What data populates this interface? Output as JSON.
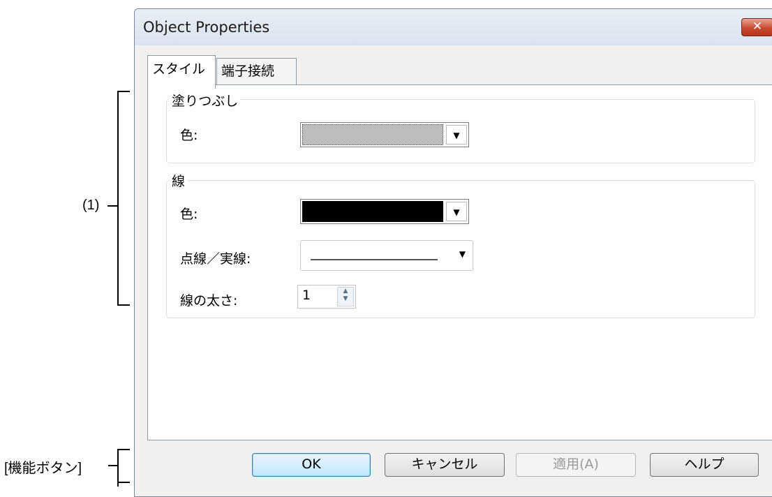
{
  "annotations": {
    "section_1": "(1)",
    "function_buttons": "[機能ボタン]"
  },
  "window": {
    "title": "Object Properties",
    "close_glyph": "✕"
  },
  "tabs": [
    {
      "label": "スタイル",
      "active": true
    },
    {
      "label": "端子接続",
      "active": false
    }
  ],
  "fill_group": {
    "legend": "塗りつぶし",
    "color_label": "色:",
    "color_value": "#bdbdbd"
  },
  "line_group": {
    "legend": "線",
    "color_label": "色:",
    "color_value": "#000000",
    "style_label": "点線／実線:",
    "style_value": "solid",
    "width_label": "線の太さ:",
    "width_value": "1"
  },
  "buttons": {
    "ok": "OK",
    "cancel": "キャンセル",
    "apply": "適用(A)",
    "help": "ヘルプ"
  },
  "icons": {
    "dropdown": "▼",
    "spin_up": "▲",
    "spin_down": "▼"
  }
}
